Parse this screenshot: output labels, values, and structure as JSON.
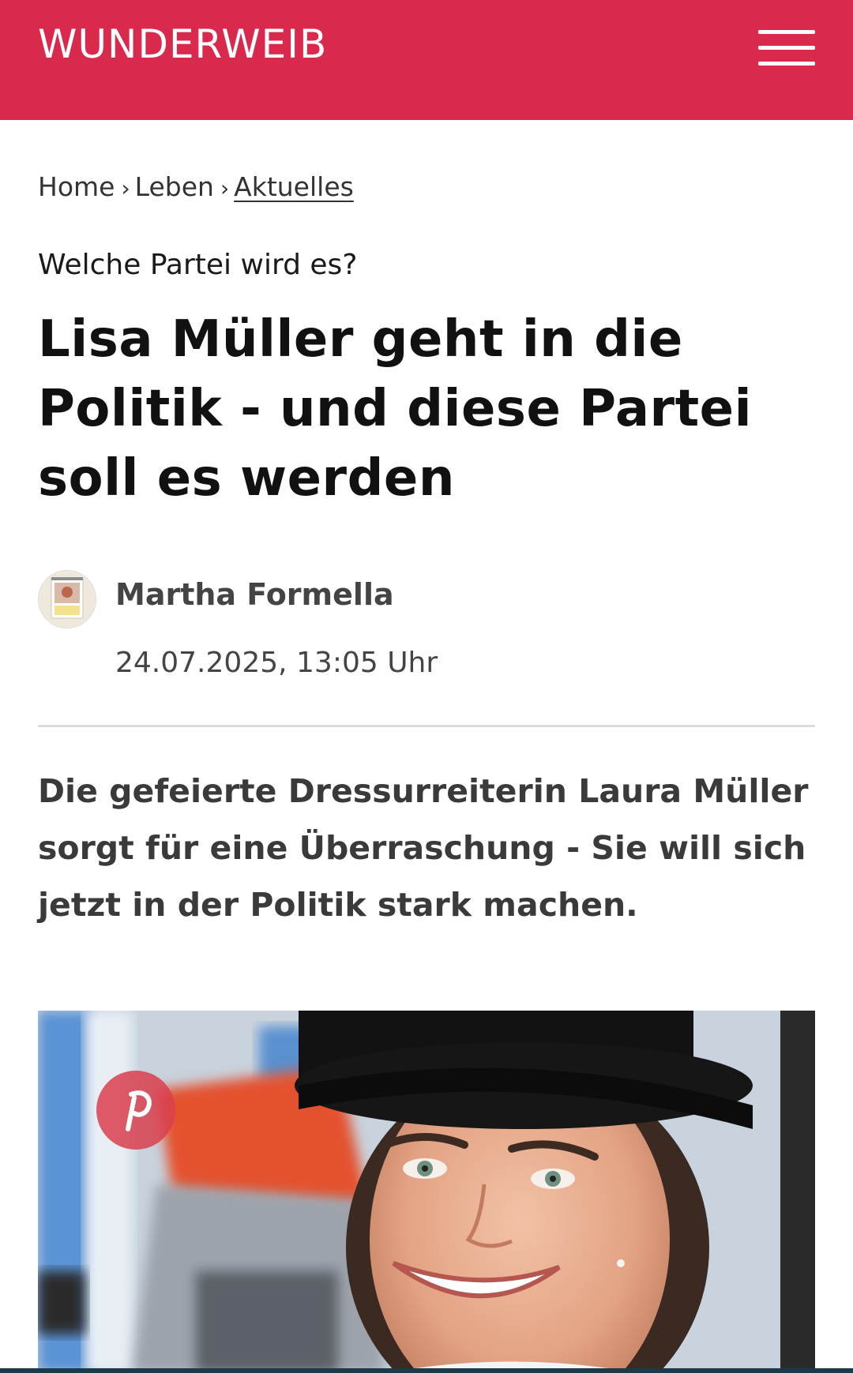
{
  "header": {
    "logo": "WUNDERWEIB",
    "brand_color": "#d92a4e",
    "menu_icon": "hamburger-menu-icon"
  },
  "breadcrumb": {
    "items": [
      "Home",
      "Leben",
      "Aktuelles"
    ],
    "separator_icon": "chevron-right-icon"
  },
  "article": {
    "kicker": "Welche Partei wird es?",
    "headline": "Lisa Müller geht in die Politik - und diese Partei soll es werden",
    "author": "Martha Formella",
    "date": "24.07.2025, 13:05 Uhr",
    "teaser": "Die gefeierte Dressurreiterin Laura Müller sorgt für eine Überraschung - Sie will sich jetzt in der Politik stark machen.",
    "image_share_icon": "pinterest-icon"
  }
}
